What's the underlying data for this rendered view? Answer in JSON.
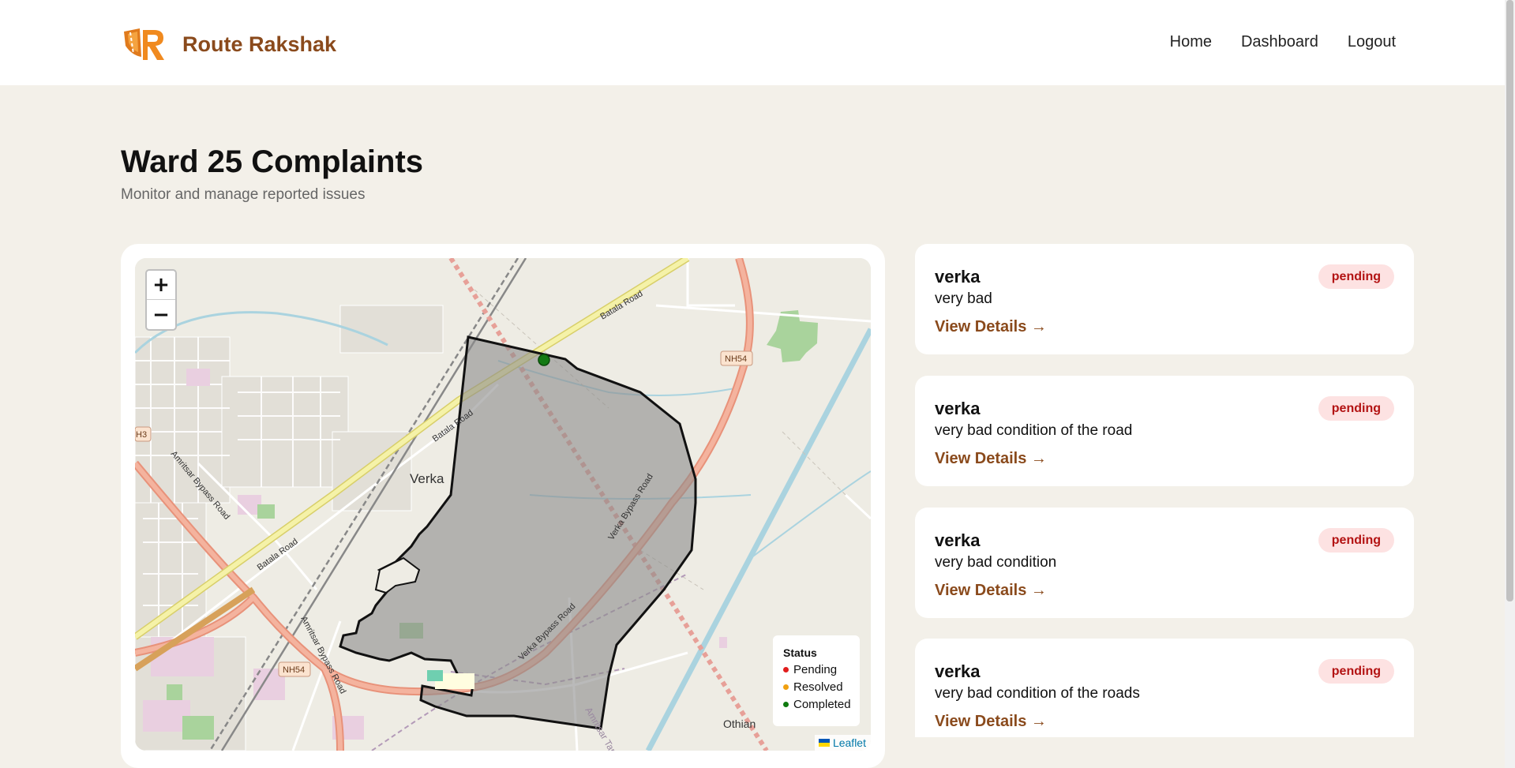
{
  "header": {
    "brand": "Route Rakshak",
    "logo_icon": "route-rakshak-logo-icon",
    "nav": [
      {
        "label": "Home"
      },
      {
        "label": "Dashboard"
      },
      {
        "label": "Logout"
      }
    ]
  },
  "page": {
    "title": "Ward 25 Complaints",
    "subtitle": "Monitor and manage reported issues"
  },
  "map": {
    "zoom_in": "+",
    "zoom_out": "−",
    "labels": {
      "area": "Verka",
      "batala_road": "Batala Road",
      "batala_road_2": "Batala Road",
      "batala_road_3": "Batala Road",
      "bypass_1": "Amritsar Bypass Road",
      "bypass_2": "Amritsar Bypass Road",
      "verka_bypass_1": "Verka Bypass Road",
      "verka_bypass_2": "Verka Bypass Road",
      "nh54_1": "NH54",
      "nh54_2": "NH54",
      "nh3": "H3",
      "othian": "Othian",
      "amritsar_tarn": "Amritsar Tarn"
    },
    "legend": {
      "title": "Status",
      "items": [
        {
          "label": "Pending",
          "color": "#e11d1d"
        },
        {
          "label": "Resolved",
          "color": "#f0a010"
        },
        {
          "label": "Completed",
          "color": "#0f7a0f"
        }
      ]
    },
    "attribution": "Leaflet",
    "colors": {
      "polygon_fill": "#8c8c8c",
      "marker": "#137a13",
      "highway": "#f0a489",
      "road_yellow": "#f4f0a0"
    }
  },
  "complaints": [
    {
      "title": "verka",
      "description": "very bad",
      "status": "pending",
      "link": "View Details →"
    },
    {
      "title": "verka",
      "description": "very bad condition of the road",
      "status": "pending",
      "link": "View Details →"
    },
    {
      "title": "verka",
      "description": "very bad condition",
      "status": "pending",
      "link": "View Details →"
    },
    {
      "title": "verka",
      "description": "very bad condition of the roads",
      "status": "pending",
      "link": "View Details →"
    }
  ]
}
